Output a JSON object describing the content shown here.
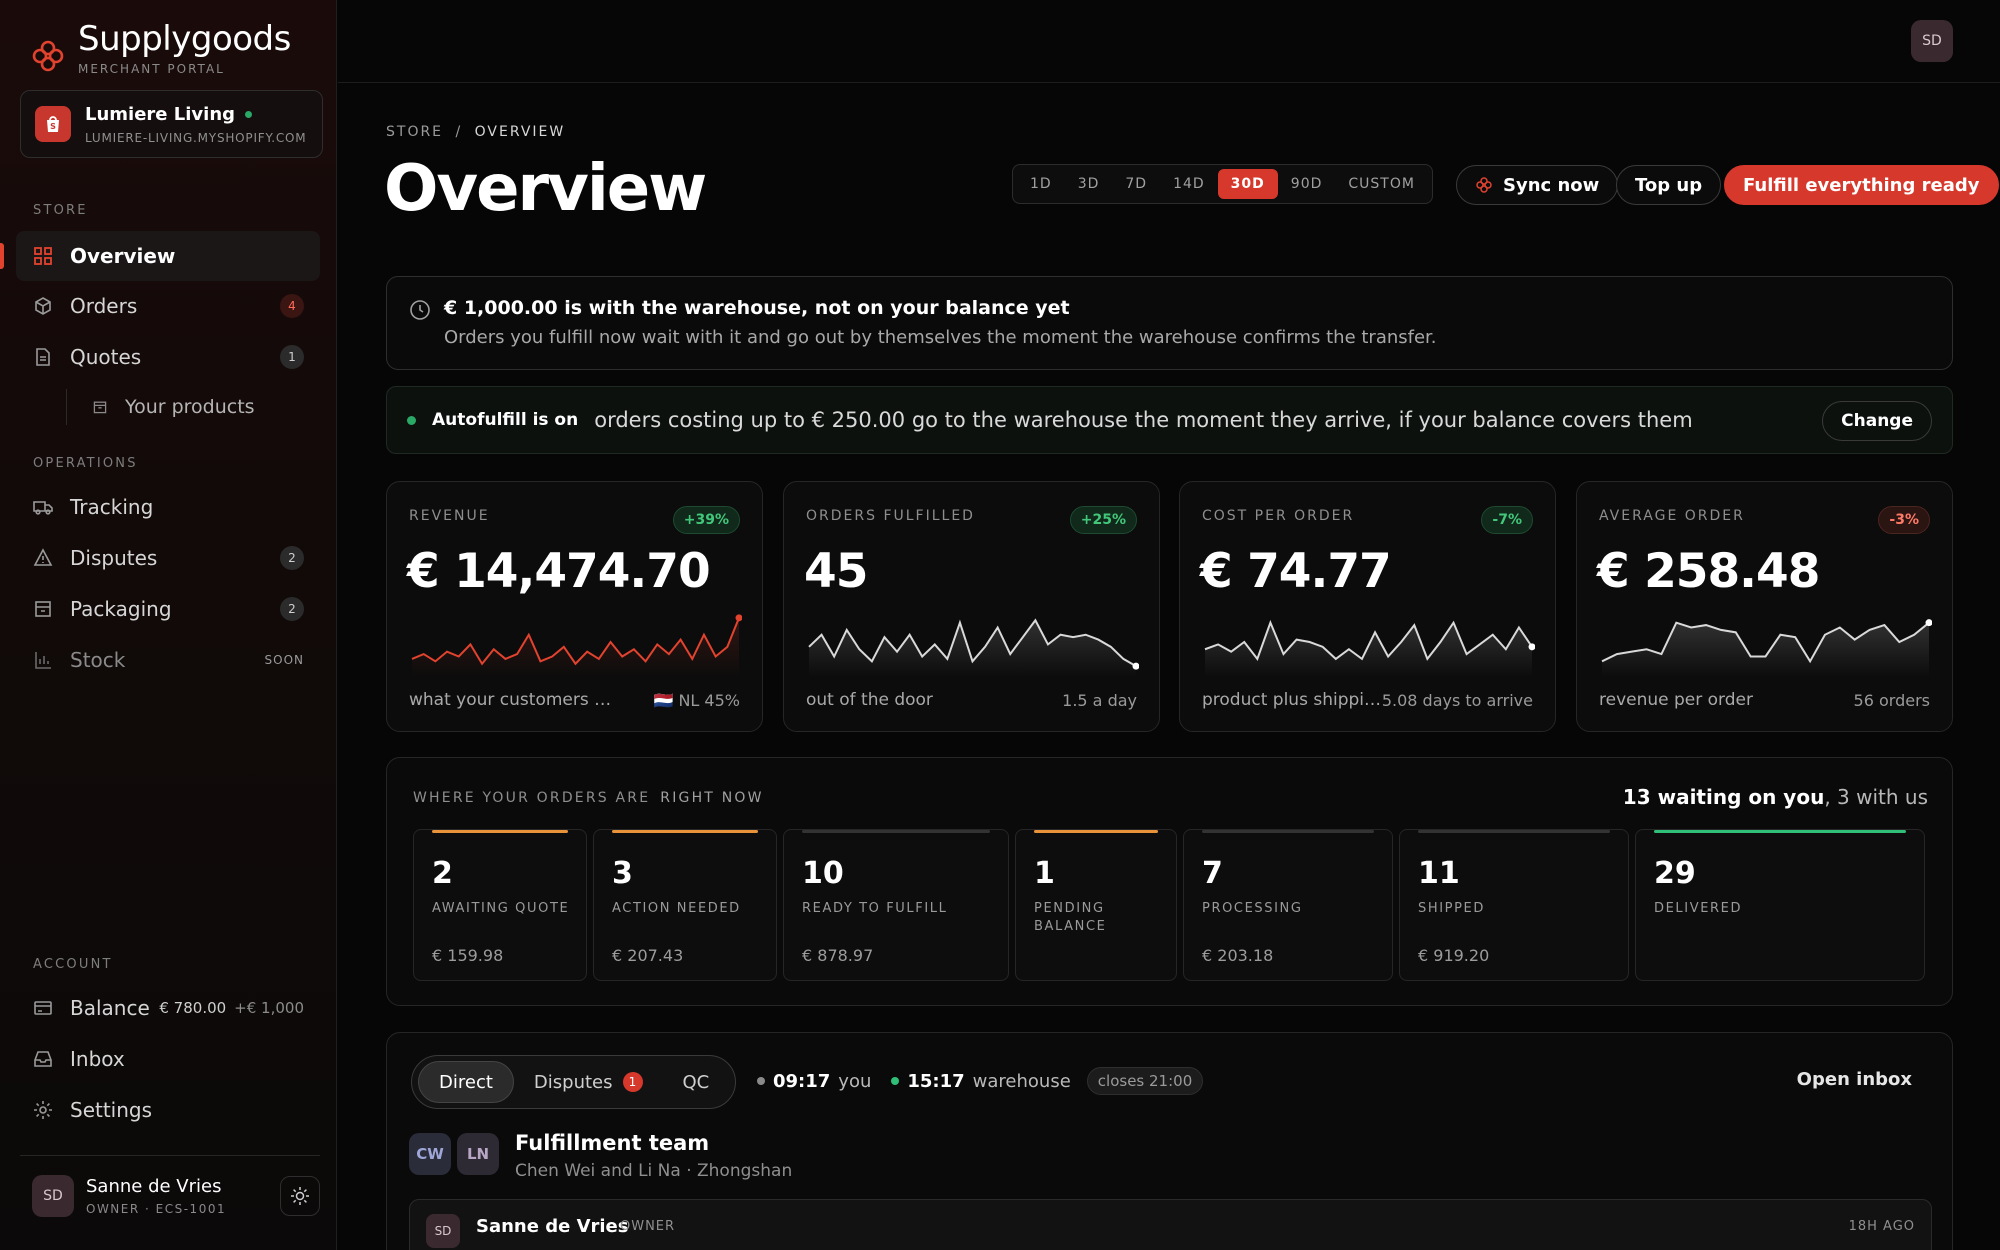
{
  "brand": {
    "name": "Supplygoods",
    "subtitle": "MERCHANT PORTAL",
    "accent": "#d7382c"
  },
  "store": {
    "name": "Lumiere Living",
    "domain": "LUMIERE-LIVING.MYSHOPIFY.COM",
    "status_color": "#2aa866"
  },
  "sidebar": {
    "store_section": "STORE",
    "operations_section": "OPERATIONS",
    "account_section": "ACCOUNT",
    "items": [
      {
        "label": "Overview",
        "icon": "grid-icon",
        "active": true
      },
      {
        "label": "Orders",
        "icon": "box-icon",
        "badge": "4"
      },
      {
        "label": "Quotes",
        "icon": "document-icon",
        "badge": "1"
      },
      {
        "label": "Your products",
        "icon": "package-icon"
      },
      {
        "label": "Tracking",
        "icon": "truck-icon"
      },
      {
        "label": "Disputes",
        "icon": "warning-icon",
        "badge": "2"
      },
      {
        "label": "Packaging",
        "icon": "package-icon",
        "badge": "2"
      },
      {
        "label": "Stock",
        "icon": "bar-chart-icon",
        "tag": "SOON"
      },
      {
        "label": "Balance",
        "icon": "card-icon",
        "value": "€ 780.00",
        "pending": "+€ 1,000"
      },
      {
        "label": "Inbox",
        "icon": "inbox-icon"
      },
      {
        "label": "Settings",
        "icon": "gear-icon"
      }
    ]
  },
  "user": {
    "initials": "SD",
    "name": "Sanne de Vries",
    "role": "OWNER · ECS-1001"
  },
  "breadcrumb": {
    "root": "STORE",
    "sep": "/",
    "current": "OVERVIEW"
  },
  "page_title": "Overview",
  "ranges": [
    "1D",
    "3D",
    "7D",
    "14D",
    "30D",
    "90D",
    "CUSTOM"
  ],
  "selected_range": "30D",
  "actions": {
    "sync": "Sync now",
    "topup": "Top up",
    "fulfill": "Fulfill everything ready"
  },
  "notice": {
    "title": "€ 1,000.00 is with the warehouse, not on your balance yet",
    "body": "Orders you fulfill now wait with it and go out by themselves the moment the warehouse confirms the transfer."
  },
  "autofulfill": {
    "label": "Autofulfill is on",
    "text": "orders costing up to € 250.00 go to the warehouse the moment they arrive, if your balance covers them",
    "button": "Change"
  },
  "kpis": [
    {
      "label": "REVENUE",
      "delta": "+39%",
      "trend": "up",
      "value": "€ 14,474.70",
      "foot_left": "what your customers paid",
      "foot_right": "🇳🇱 NL 45%",
      "color": "#e2432f",
      "spark": [
        10,
        14,
        8,
        16,
        12,
        22,
        6,
        18,
        10,
        14,
        30,
        8,
        12,
        20,
        6,
        16,
        10,
        24,
        12,
        18,
        8,
        22,
        14,
        26,
        10,
        30,
        12,
        20,
        44
      ]
    },
    {
      "label": "ORDERS FULFILLED",
      "delta": "+25%",
      "trend": "up",
      "value": "45",
      "foot_left": "out of the door",
      "foot_right": "1.5 a day",
      "color": "#d9d9d9",
      "spark": [
        20,
        30,
        12,
        34,
        18,
        8,
        28,
        16,
        30,
        12,
        22,
        10,
        40,
        8,
        20,
        36,
        14,
        28,
        42,
        22,
        30,
        28,
        30,
        26,
        20,
        10,
        4
      ]
    },
    {
      "label": "COST PER ORDER",
      "delta": "-7%",
      "trend": "up",
      "value": "€ 74.77",
      "foot_left": "product plus shipping",
      "foot_right": "5.08 days to arrive",
      "color": "#d9d9d9",
      "spark": [
        18,
        22,
        16,
        24,
        10,
        40,
        14,
        26,
        24,
        20,
        10,
        18,
        10,
        32,
        12,
        24,
        38,
        10,
        24,
        40,
        14,
        22,
        30,
        18,
        36,
        20
      ]
    },
    {
      "label": "AVERAGE ORDER",
      "delta": "-3%",
      "trend": "down",
      "value": "€ 258.48",
      "foot_left": "revenue per order",
      "foot_right": "56 orders",
      "color": "#d9d9d9",
      "spark": [
        8,
        14,
        16,
        18,
        14,
        40,
        36,
        38,
        34,
        32,
        12,
        12,
        30,
        28,
        8,
        30,
        36,
        26,
        34,
        38,
        24,
        30,
        40
      ]
    }
  ],
  "pipeline": {
    "label": "WHERE YOUR ORDERS ARE",
    "label_suffix": "RIGHT NOW",
    "summary_bold": "13 waiting on you",
    "summary_rest": ", 3 with us",
    "stages": [
      {
        "count": "2",
        "name": "AWAITING QUOTE",
        "amount": "€ 159.98",
        "color": "#e8923a"
      },
      {
        "count": "3",
        "name": "ACTION NEEDED",
        "amount": "€ 207.43",
        "color": "#e8923a"
      },
      {
        "count": "10",
        "name": "READY TO FULFILL",
        "amount": "€ 878.97",
        "color": "#333333"
      },
      {
        "count": "1",
        "name": "PENDING BALANCE",
        "amount": "",
        "color": "#e8923a"
      },
      {
        "count": "7",
        "name": "PROCESSING",
        "amount": "€ 203.18",
        "color": "#333333"
      },
      {
        "count": "11",
        "name": "SHIPPED",
        "amount": "€ 919.20",
        "color": "#333333"
      },
      {
        "count": "29",
        "name": "DELIVERED",
        "amount": "",
        "color": "#2fbf77"
      }
    ]
  },
  "inbox": {
    "tabs": [
      "Direct",
      "Disputes",
      "QC"
    ],
    "disputes_count": "1",
    "your_time": "09:17",
    "your_label": "you",
    "warehouse_time": "15:17",
    "warehouse_label": "warehouse",
    "closes": "closes 21:00",
    "open_label": "Open inbox",
    "team_initials": [
      "CW",
      "LN"
    ],
    "team_name": "Fulfillment team",
    "team_sub": "Chen Wei and Li Na · Zhongshan",
    "message": {
      "initials": "SD",
      "author": "Sanne de Vries",
      "role": "OWNER",
      "time": "18H AGO"
    }
  }
}
